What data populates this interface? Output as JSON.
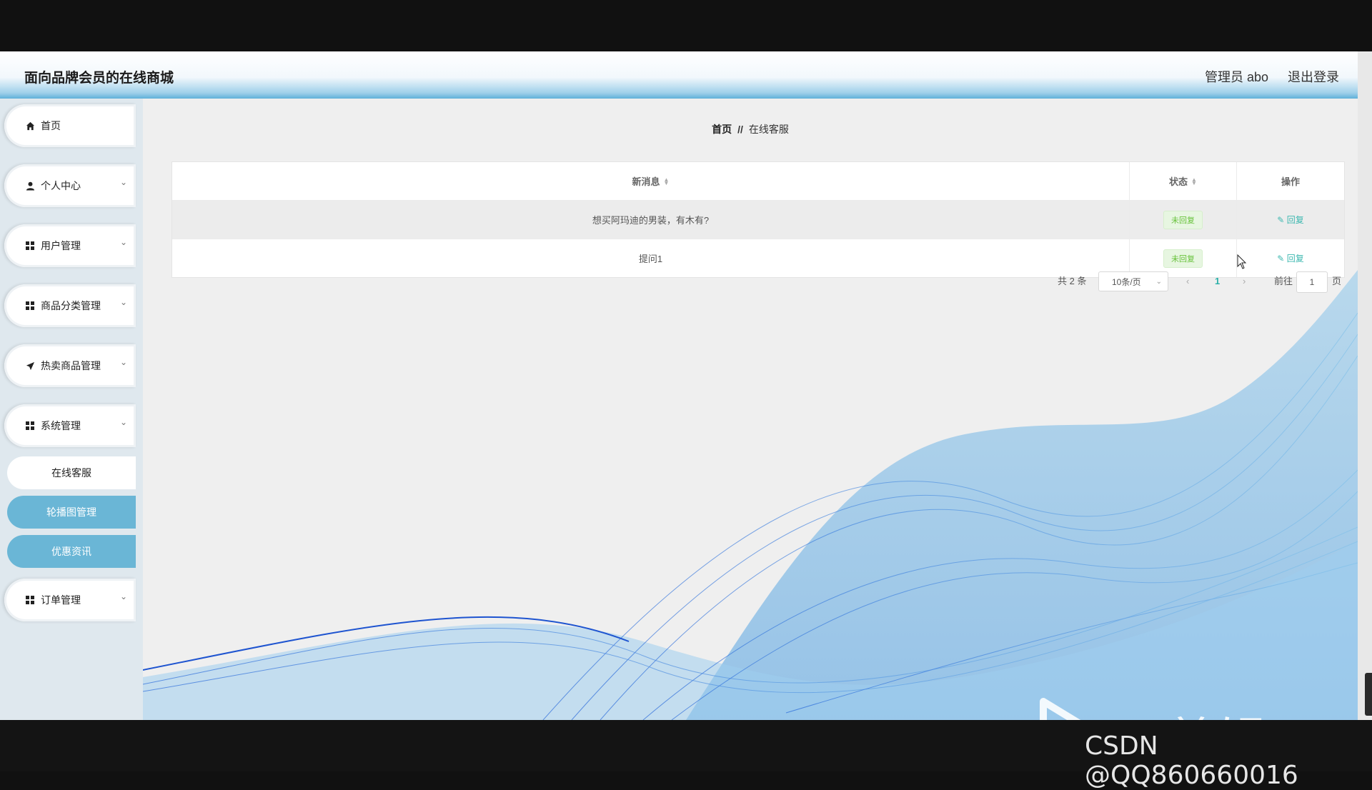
{
  "header": {
    "site_title": "面向品牌会员的在线商城",
    "user_label": "管理员 abo",
    "logout_label": "退出登录"
  },
  "sidebar": {
    "items": [
      {
        "label": "首页",
        "icon": "home-icon"
      },
      {
        "label": "个人中心",
        "icon": "user-icon"
      },
      {
        "label": "用户管理",
        "icon": "grid-icon"
      },
      {
        "label": "商品分类管理",
        "icon": "grid-icon"
      },
      {
        "label": "热卖商品管理",
        "icon": "send-icon"
      },
      {
        "label": "系统管理",
        "icon": "grid-icon"
      },
      {
        "label": "订单管理",
        "icon": "grid-icon"
      }
    ],
    "submenu": [
      "在线客服",
      "轮播图管理",
      "优惠资讯"
    ]
  },
  "breadcrumb": {
    "home": "首页",
    "separator": "//",
    "current": "在线客服"
  },
  "table": {
    "columns": [
      "新消息",
      "状态",
      "操作"
    ],
    "rows": [
      {
        "message": "想买阿玛迪的男装，有木有?",
        "status": "未回复",
        "action": "回复"
      },
      {
        "message": "提问1",
        "status": "未回复",
        "action": "回复"
      }
    ]
  },
  "pagination": {
    "total": "共 2 条",
    "page_size": "10条/页",
    "current_page": "1",
    "goto_label": "前往",
    "goto_value": "1",
    "page_suffix": "页"
  },
  "watermarks": {
    "editor": "ev剪辑",
    "csdn": "CSDN @QQ860660016"
  },
  "colors": {
    "accent_blue": "#6ab6d6",
    "teal": "#2bb0a8",
    "status_green": "#67c23a"
  }
}
